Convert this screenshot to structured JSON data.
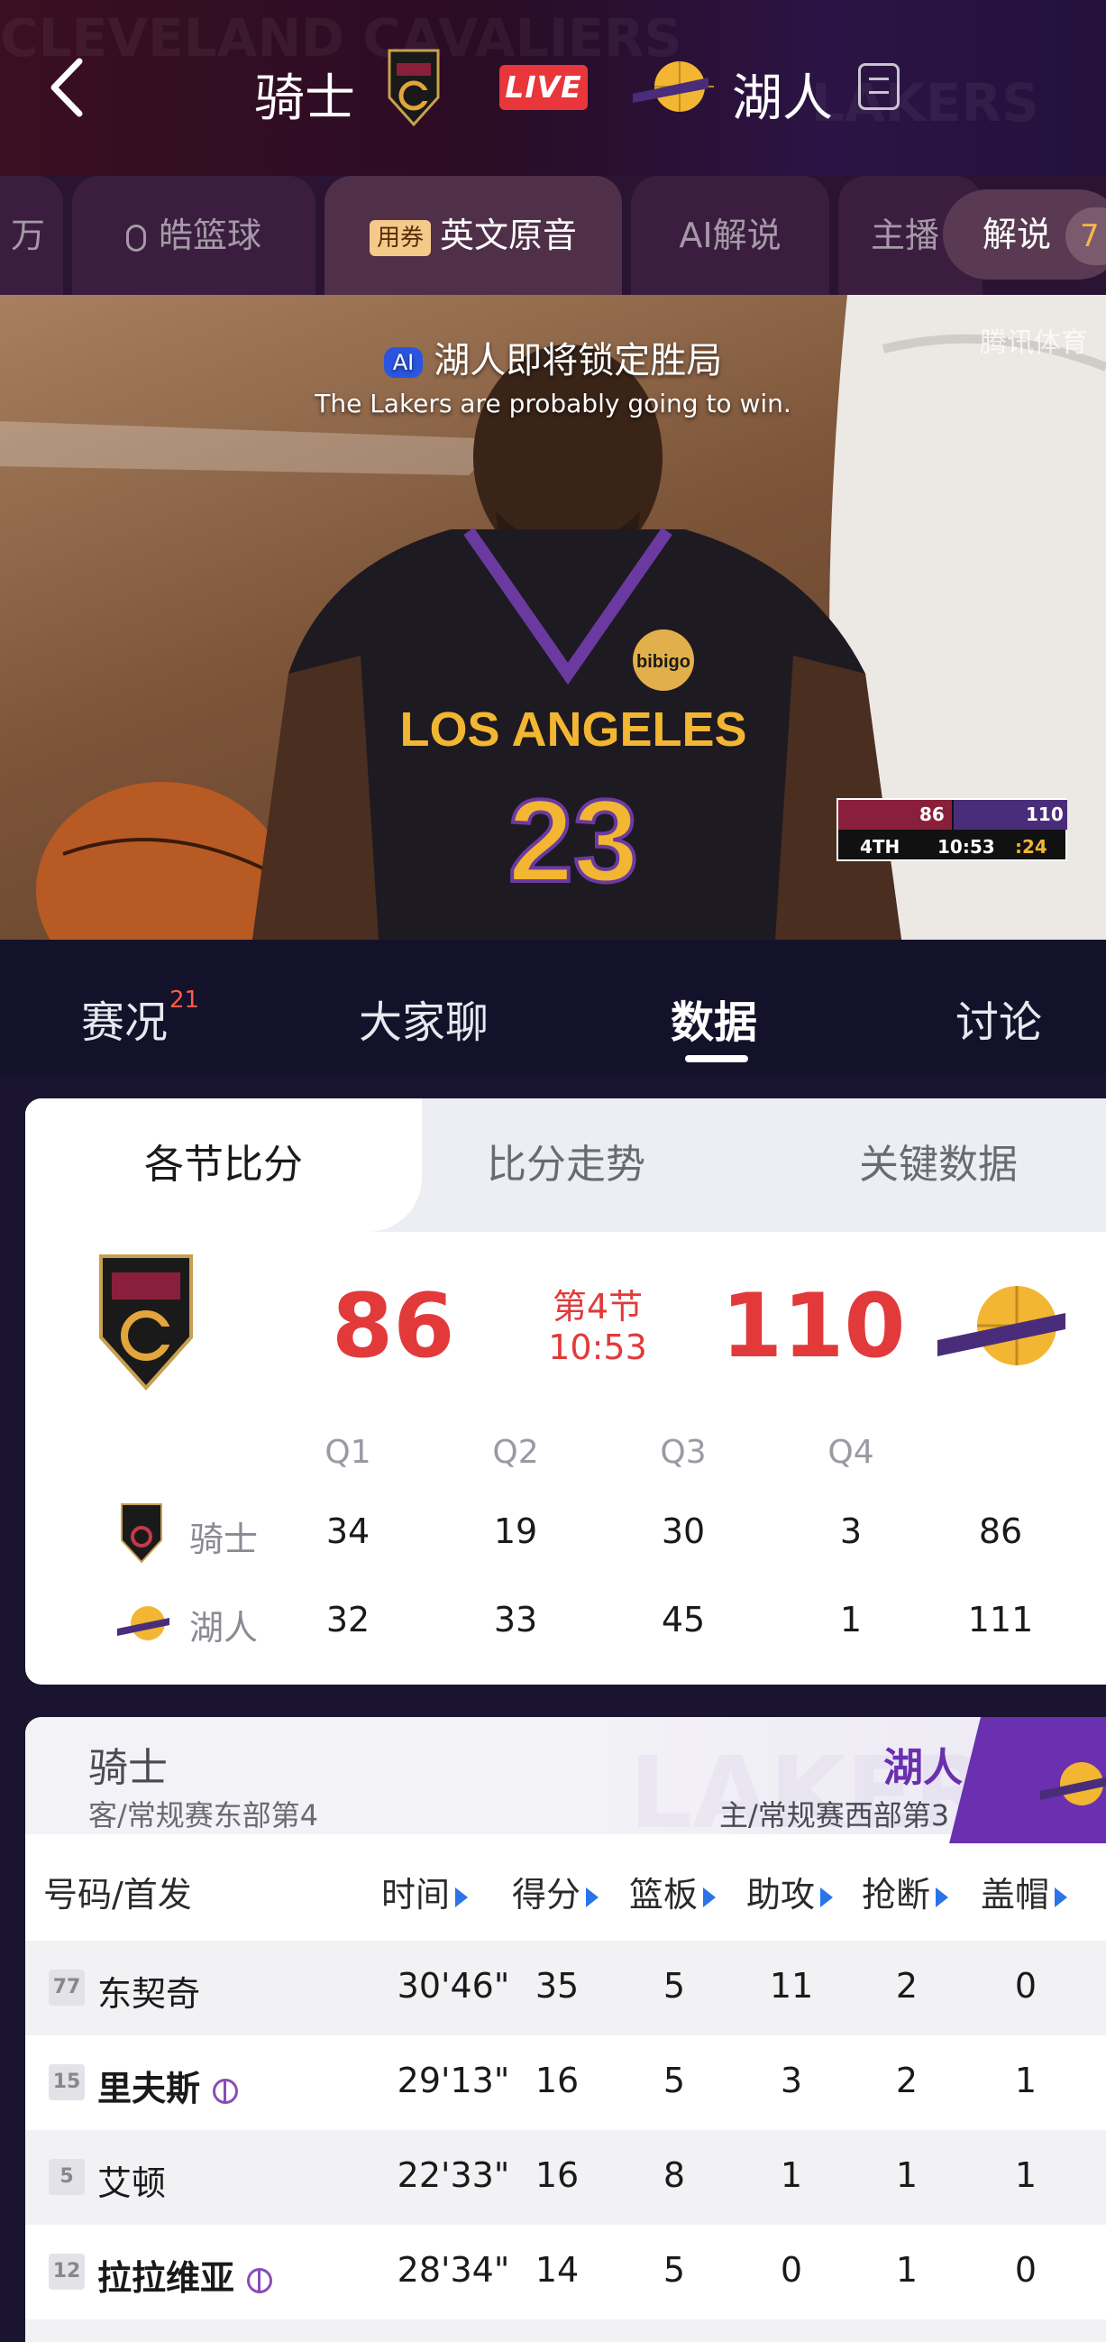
{
  "header": {
    "away_team": "骑士",
    "home_team": "湖人",
    "live_label": "LIVE",
    "watermark": "CLEVELAND CAVALIERS",
    "watermark2": "LAKERS"
  },
  "channels": {
    "items": [
      {
        "label": "万"
      },
      {
        "label": "皓篮球"
      },
      {
        "label": "英文原音",
        "coupon": "用券"
      },
      {
        "label": "AI解说"
      },
      {
        "label": "主播"
      }
    ],
    "commentary_label": "解说",
    "commentary_badge": "7"
  },
  "video": {
    "ai_badge": "AI",
    "caption_cn": "湖人即将锁定胜局",
    "caption_en": "The Lakers are probably going to win.",
    "watermark": "腾讯体育",
    "jersey_text": "LOS ANGELES",
    "jersey_number": "23",
    "sponsor": "bibigo",
    "mini_board": {
      "away_score": "86",
      "home_score": "110",
      "quarter": "4TH",
      "clock": "10:53",
      "shot_clock": ":24"
    }
  },
  "main_tabs": {
    "items": [
      {
        "label": "赛况",
        "badge": "21"
      },
      {
        "label": "大家聊"
      },
      {
        "label": "数据"
      },
      {
        "label": "讨论"
      }
    ]
  },
  "scoreboard": {
    "subtabs": [
      "各节比分",
      "比分走势",
      "关键数据"
    ],
    "away_score": "86",
    "home_score": "110",
    "quarter": "第4节",
    "clock": "10:53",
    "headers": [
      "Q1",
      "Q2",
      "Q3",
      "Q4"
    ],
    "rows": [
      {
        "team": "骑士",
        "q": [
          "34",
          "19",
          "30",
          "3"
        ],
        "total": "86"
      },
      {
        "team": "湖人",
        "q": [
          "32",
          "33",
          "45",
          "1"
        ],
        "total": "111"
      }
    ]
  },
  "player_stats": {
    "away_team": "骑士",
    "away_info": "客/常规赛东部第4",
    "home_team": "湖人",
    "home_info": "主/常规赛西部第3",
    "watermark": "LAKERS",
    "col_player": "号码/首发",
    "columns": [
      "时间",
      "得分",
      "篮板",
      "助攻",
      "抢断",
      "盖帽"
    ],
    "players": [
      {
        "number": "77",
        "name": "东契奇",
        "bold": false,
        "icon": false,
        "stats": [
          "30'46\"",
          "35",
          "5",
          "11",
          "2",
          "0"
        ]
      },
      {
        "number": "15",
        "name": "里夫斯",
        "bold": true,
        "icon": true,
        "stats": [
          "29'13\"",
          "16",
          "5",
          "3",
          "2",
          "1"
        ]
      },
      {
        "number": "5",
        "name": "艾顿",
        "bold": false,
        "icon": false,
        "stats": [
          "22'33\"",
          "16",
          "8",
          "1",
          "1",
          "1"
        ]
      },
      {
        "number": "12",
        "name": "拉拉维亚",
        "bold": true,
        "icon": true,
        "stats": [
          "28'34\"",
          "14",
          "5",
          "0",
          "1",
          "0"
        ]
      }
    ]
  },
  "colors": {
    "accent_red": "#e23a3a",
    "lakers_purple": "#6a30b0",
    "cavs_wine": "#8a1f3b",
    "lakers_gold": "#f2b632",
    "live_red": "#e8363a"
  }
}
